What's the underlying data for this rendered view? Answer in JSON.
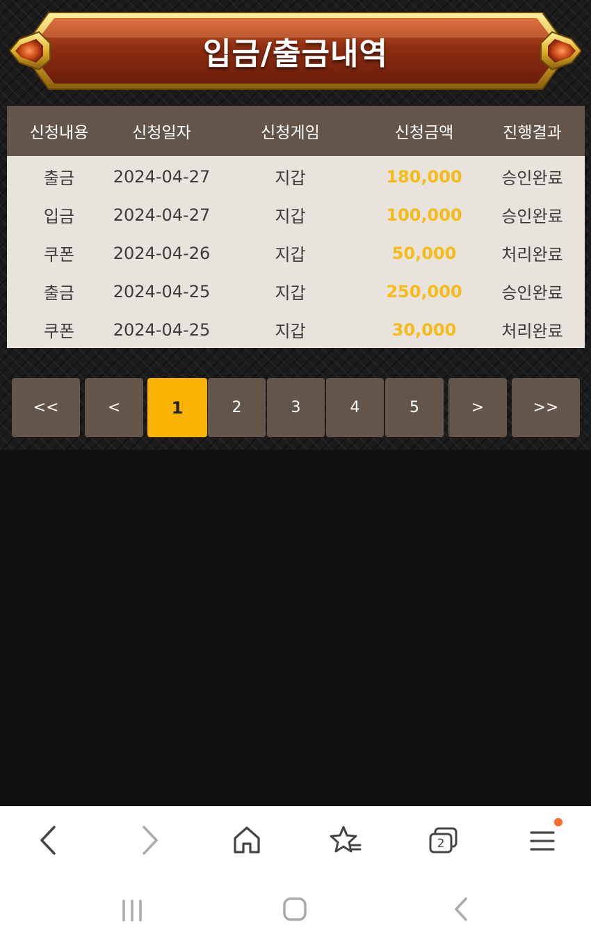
{
  "title": "입금/출금내역",
  "table": {
    "headers": [
      "신청내용",
      "신청일자",
      "신청게임",
      "신청금액",
      "진행결과"
    ],
    "rows": [
      {
        "type": "출금",
        "date": "2024-04-27",
        "game": "지갑",
        "amount": "180,000",
        "status": "승인완료"
      },
      {
        "type": "입금",
        "date": "2024-04-27",
        "game": "지갑",
        "amount": "100,000",
        "status": "승인완료"
      },
      {
        "type": "쿠폰",
        "date": "2024-04-26",
        "game": "지갑",
        "amount": "50,000",
        "status": "처리완료"
      },
      {
        "type": "출금",
        "date": "2024-04-25",
        "game": "지갑",
        "amount": "250,000",
        "status": "승인완료"
      },
      {
        "type": "쿠폰",
        "date": "2024-04-25",
        "game": "지갑",
        "amount": "30,000",
        "status": "처리완료"
      }
    ]
  },
  "pagination": {
    "first": "<<",
    "prev": "<",
    "pages": [
      "1",
      "2",
      "3",
      "4",
      "5"
    ],
    "current": "1",
    "next": ">",
    "last": ">>"
  },
  "browser": {
    "tab_count": "2",
    "icons": [
      "back-icon",
      "forward-icon",
      "home-icon",
      "bookmark-star-icon",
      "tabs-icon",
      "menu-icon"
    ],
    "has_notification_dot": true
  },
  "colors": {
    "accent": "#f8b400",
    "amount": "#f5bb16",
    "header_bg": "#63554a",
    "row_bg": "#e8e4dd",
    "banner": "#8a2c10"
  }
}
